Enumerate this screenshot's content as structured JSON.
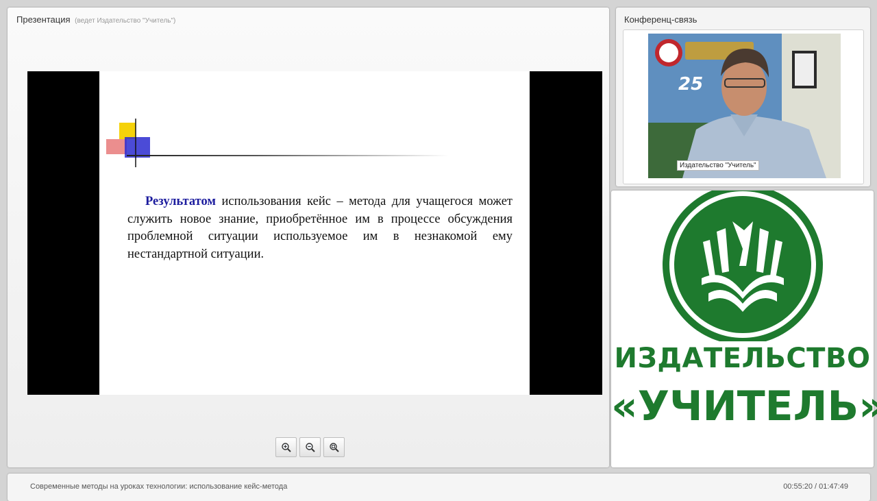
{
  "presentation": {
    "title": "Презентация",
    "presenter_note": "(ведет Издательство \"Учитель\")",
    "slide": {
      "bold_lead": "Результатом",
      "body": " использования кейс – метода для учащегося может служить новое знание, приобретённое им в процессе обсуждения проблемной ситуации используемое им в незнакомой ему нестандартной ситуации."
    },
    "zoom_controls": [
      {
        "icon": "zoom-in-icon"
      },
      {
        "icon": "zoom-out-icon"
      },
      {
        "icon": "zoom-fit-icon"
      }
    ]
  },
  "conference": {
    "title": "Конференц-связь",
    "participant_name": "Издательство \"Учитель\""
  },
  "logo": {
    "line1": "ИЗДАТЕЛЬСТВО",
    "line2": "«УЧИТЕЛЬ»",
    "brand_color": "#1e7a2e"
  },
  "footer": {
    "lecture_title": "Современные методы на уроках технологии: использование кейс-метода",
    "timecode": "00:55:20 / 01:47:49"
  }
}
